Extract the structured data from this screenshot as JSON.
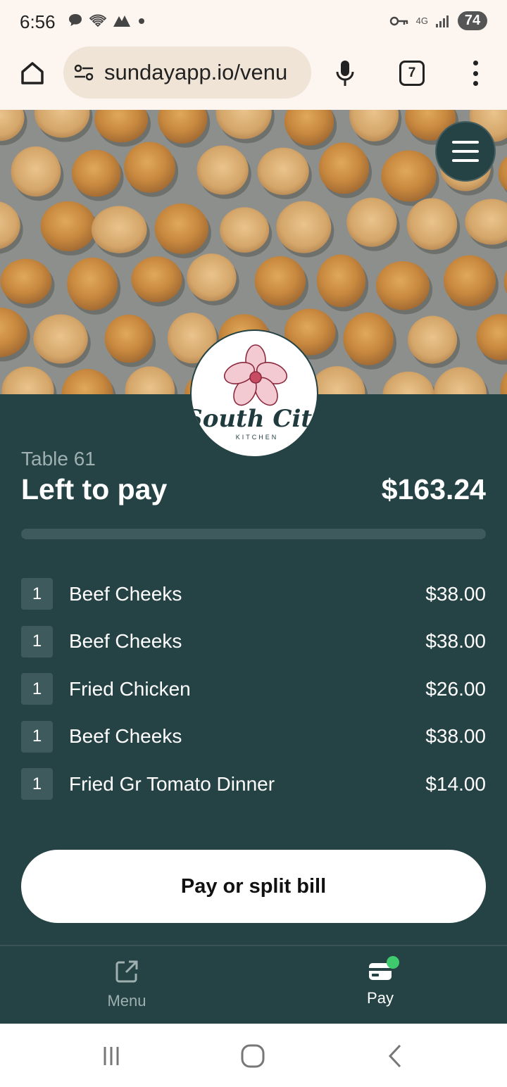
{
  "status_bar": {
    "time": "6:56",
    "network": "4G",
    "battery": "74",
    "icons_left": [
      "chat-bubble-icon",
      "wifi-icon",
      "mountain-icon",
      "dot-icon"
    ],
    "icons_right": [
      "key-icon",
      "network-4g-icon",
      "signal-icon",
      "battery-icon"
    ]
  },
  "browser": {
    "url": "sundayapp.io/venu",
    "tab_count": "7"
  },
  "restaurant": {
    "logo_name": "South City",
    "logo_sub": "KITCHEN"
  },
  "bill": {
    "table_label": "Table 61",
    "left_to_pay_label": "Left to pay",
    "amount": "$163.24",
    "paid_fraction": 0,
    "items": [
      {
        "qty": "1",
        "name": "Beef Cheeks",
        "price": "$38.00"
      },
      {
        "qty": "1",
        "name": "Beef Cheeks",
        "price": "$38.00"
      },
      {
        "qty": "1",
        "name": "Fried Chicken",
        "price": "$26.00"
      },
      {
        "qty": "1",
        "name": "Beef Cheeks",
        "price": "$38.00"
      },
      {
        "qty": "1",
        "name": "Fried Gr Tomato Dinner",
        "price": "$14.00"
      }
    ],
    "pay_button": "Pay or split bill"
  },
  "bottom_nav": {
    "menu_label": "Menu",
    "pay_label": "Pay"
  },
  "colors": {
    "panel": "#254245",
    "accent_dot": "#3ecb6d"
  }
}
